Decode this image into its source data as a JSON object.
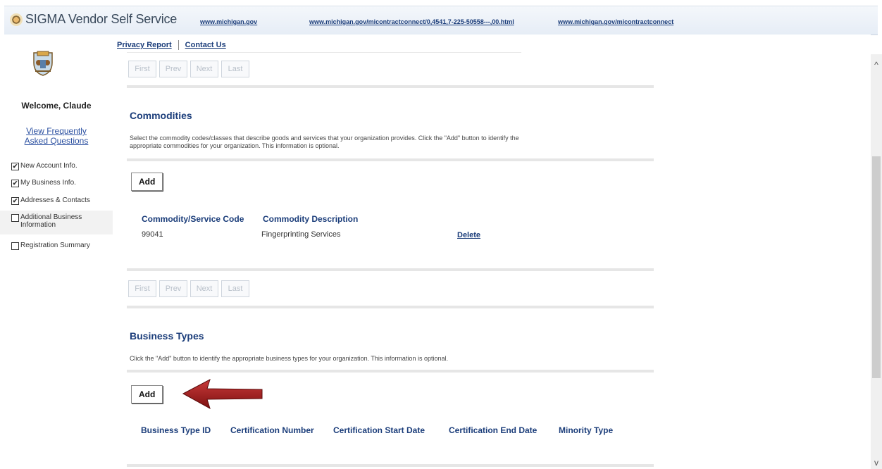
{
  "header": {
    "brand_title": "SIGMA Vendor Self Service",
    "links": [
      "www.michigan.gov",
      "www.michigan.gov/micontractconnect/0,4541,7-225-50558---,00.html",
      "www.michigan.gov/micontractconnect"
    ]
  },
  "toplinks": {
    "privacy": "Privacy Report",
    "contact": "Contact Us"
  },
  "sidebar": {
    "welcome": "Welcome, Claude",
    "faq_line1": "View Frequently",
    "faq_line2": "Asked Questions",
    "items": [
      {
        "label": "New Account Info.",
        "checked": "✔"
      },
      {
        "label": "My Business Info.",
        "checked": "✔"
      },
      {
        "label": "Addresses & Contacts",
        "checked": "✔"
      },
      {
        "label": "Additional Business Information",
        "checked": ""
      },
      {
        "label": "Registration Summary",
        "checked": ""
      }
    ]
  },
  "pager": {
    "first": "First",
    "prev": "Prev",
    "next": "Next",
    "last": "Last"
  },
  "commodities": {
    "title": "Commodities",
    "description": "Select the commodity codes/classes that describe goods and services that your organization provides. Click the \"Add\" button to identify the appropriate commodities for your organization. This information is optional.",
    "add_label": "Add",
    "columns": [
      "Commodity/Service Code",
      "Commodity Description"
    ],
    "rows": [
      {
        "code": "99041",
        "description": "Fingerprinting Services",
        "action": "Delete"
      }
    ]
  },
  "business_types": {
    "title": "Business Types",
    "description": "Click the \"Add\" button to identify the appropriate business types for your organization. This information is optional.",
    "add_label": "Add",
    "columns": [
      "Business Type ID",
      "Certification Number",
      "Certification Start Date",
      "Certification End Date",
      "Minority Type"
    ]
  },
  "colors": {
    "link": "#1b3d7a",
    "arrow": "#a11d1d"
  },
  "icons": {
    "scroll_up": "^",
    "scroll_down": "v"
  }
}
